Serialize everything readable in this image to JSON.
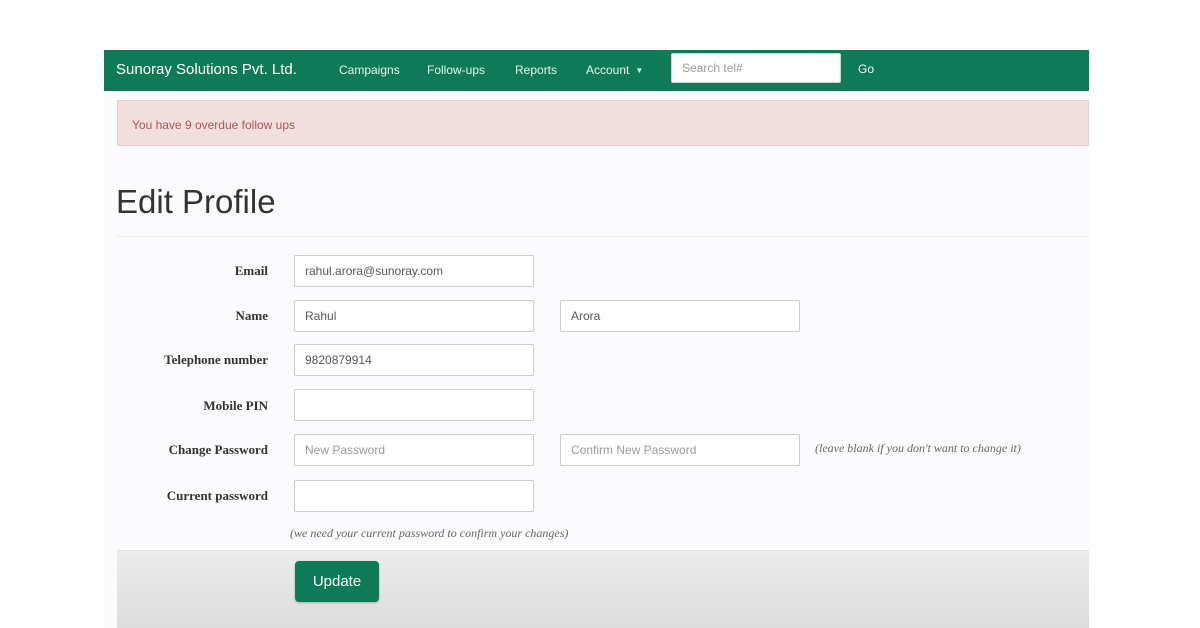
{
  "navbar": {
    "brand": "Sunoray Solutions Pvt. Ltd.",
    "items": [
      "Campaigns",
      "Follow-ups",
      "Reports",
      "Account"
    ],
    "search_placeholder": "Search tel#",
    "go_label": "Go",
    "color": "#0e7a57"
  },
  "alert": {
    "text": "You have 9 overdue follow ups"
  },
  "page": {
    "title": "Edit Profile"
  },
  "form": {
    "email_label": "Email",
    "email_value": "rahul.arora@sunoray.com",
    "name_label": "Name",
    "first_name_value": "Rahul",
    "last_name_value": "Arora",
    "telephone_label": "Telephone number",
    "telephone_value": "9820879914",
    "mobile_pin_label": "Mobile PIN",
    "mobile_pin_value": "",
    "change_password_label": "Change Password",
    "new_password_placeholder": "New Password",
    "confirm_password_placeholder": "Confirm New Password",
    "change_password_hint": "(leave blank if you don't want to change it)",
    "current_password_label": "Current password",
    "current_password_hint": "(we need your current password to confirm your changes)",
    "update_label": "Update"
  }
}
